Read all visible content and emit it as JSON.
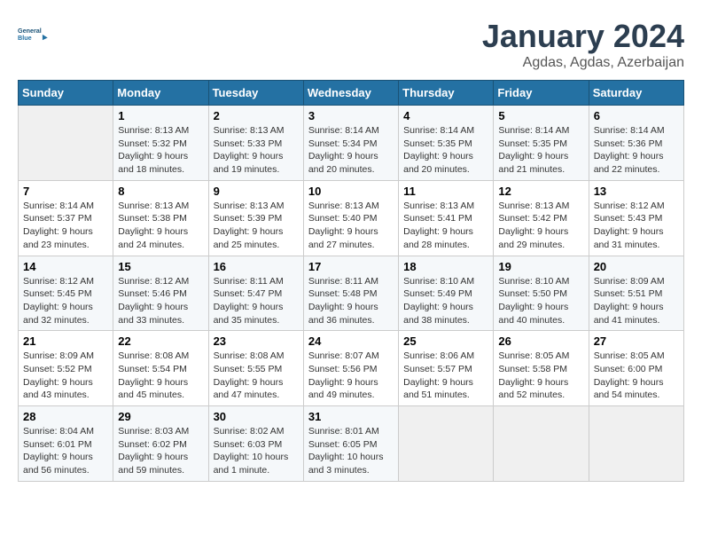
{
  "header": {
    "logo_line1": "General",
    "logo_line2": "Blue",
    "title": "January 2024",
    "subtitle": "Agdas, Agdas, Azerbaijan"
  },
  "days_of_week": [
    "Sunday",
    "Monday",
    "Tuesday",
    "Wednesday",
    "Thursday",
    "Friday",
    "Saturday"
  ],
  "weeks": [
    [
      {
        "day": "",
        "sunrise": "",
        "sunset": "",
        "daylight": "",
        "empty": true
      },
      {
        "day": "1",
        "sunrise": "Sunrise: 8:13 AM",
        "sunset": "Sunset: 5:32 PM",
        "daylight": "Daylight: 9 hours and 18 minutes.",
        "empty": false
      },
      {
        "day": "2",
        "sunrise": "Sunrise: 8:13 AM",
        "sunset": "Sunset: 5:33 PM",
        "daylight": "Daylight: 9 hours and 19 minutes.",
        "empty": false
      },
      {
        "day": "3",
        "sunrise": "Sunrise: 8:14 AM",
        "sunset": "Sunset: 5:34 PM",
        "daylight": "Daylight: 9 hours and 20 minutes.",
        "empty": false
      },
      {
        "day": "4",
        "sunrise": "Sunrise: 8:14 AM",
        "sunset": "Sunset: 5:35 PM",
        "daylight": "Daylight: 9 hours and 20 minutes.",
        "empty": false
      },
      {
        "day": "5",
        "sunrise": "Sunrise: 8:14 AM",
        "sunset": "Sunset: 5:35 PM",
        "daylight": "Daylight: 9 hours and 21 minutes.",
        "empty": false
      },
      {
        "day": "6",
        "sunrise": "Sunrise: 8:14 AM",
        "sunset": "Sunset: 5:36 PM",
        "daylight": "Daylight: 9 hours and 22 minutes.",
        "empty": false
      }
    ],
    [
      {
        "day": "7",
        "sunrise": "Sunrise: 8:14 AM",
        "sunset": "Sunset: 5:37 PM",
        "daylight": "Daylight: 9 hours and 23 minutes.",
        "empty": false
      },
      {
        "day": "8",
        "sunrise": "Sunrise: 8:13 AM",
        "sunset": "Sunset: 5:38 PM",
        "daylight": "Daylight: 9 hours and 24 minutes.",
        "empty": false
      },
      {
        "day": "9",
        "sunrise": "Sunrise: 8:13 AM",
        "sunset": "Sunset: 5:39 PM",
        "daylight": "Daylight: 9 hours and 25 minutes.",
        "empty": false
      },
      {
        "day": "10",
        "sunrise": "Sunrise: 8:13 AM",
        "sunset": "Sunset: 5:40 PM",
        "daylight": "Daylight: 9 hours and 27 minutes.",
        "empty": false
      },
      {
        "day": "11",
        "sunrise": "Sunrise: 8:13 AM",
        "sunset": "Sunset: 5:41 PM",
        "daylight": "Daylight: 9 hours and 28 minutes.",
        "empty": false
      },
      {
        "day": "12",
        "sunrise": "Sunrise: 8:13 AM",
        "sunset": "Sunset: 5:42 PM",
        "daylight": "Daylight: 9 hours and 29 minutes.",
        "empty": false
      },
      {
        "day": "13",
        "sunrise": "Sunrise: 8:12 AM",
        "sunset": "Sunset: 5:43 PM",
        "daylight": "Daylight: 9 hours and 31 minutes.",
        "empty": false
      }
    ],
    [
      {
        "day": "14",
        "sunrise": "Sunrise: 8:12 AM",
        "sunset": "Sunset: 5:45 PM",
        "daylight": "Daylight: 9 hours and 32 minutes.",
        "empty": false
      },
      {
        "day": "15",
        "sunrise": "Sunrise: 8:12 AM",
        "sunset": "Sunset: 5:46 PM",
        "daylight": "Daylight: 9 hours and 33 minutes.",
        "empty": false
      },
      {
        "day": "16",
        "sunrise": "Sunrise: 8:11 AM",
        "sunset": "Sunset: 5:47 PM",
        "daylight": "Daylight: 9 hours and 35 minutes.",
        "empty": false
      },
      {
        "day": "17",
        "sunrise": "Sunrise: 8:11 AM",
        "sunset": "Sunset: 5:48 PM",
        "daylight": "Daylight: 9 hours and 36 minutes.",
        "empty": false
      },
      {
        "day": "18",
        "sunrise": "Sunrise: 8:10 AM",
        "sunset": "Sunset: 5:49 PM",
        "daylight": "Daylight: 9 hours and 38 minutes.",
        "empty": false
      },
      {
        "day": "19",
        "sunrise": "Sunrise: 8:10 AM",
        "sunset": "Sunset: 5:50 PM",
        "daylight": "Daylight: 9 hours and 40 minutes.",
        "empty": false
      },
      {
        "day": "20",
        "sunrise": "Sunrise: 8:09 AM",
        "sunset": "Sunset: 5:51 PM",
        "daylight": "Daylight: 9 hours and 41 minutes.",
        "empty": false
      }
    ],
    [
      {
        "day": "21",
        "sunrise": "Sunrise: 8:09 AM",
        "sunset": "Sunset: 5:52 PM",
        "daylight": "Daylight: 9 hours and 43 minutes.",
        "empty": false
      },
      {
        "day": "22",
        "sunrise": "Sunrise: 8:08 AM",
        "sunset": "Sunset: 5:54 PM",
        "daylight": "Daylight: 9 hours and 45 minutes.",
        "empty": false
      },
      {
        "day": "23",
        "sunrise": "Sunrise: 8:08 AM",
        "sunset": "Sunset: 5:55 PM",
        "daylight": "Daylight: 9 hours and 47 minutes.",
        "empty": false
      },
      {
        "day": "24",
        "sunrise": "Sunrise: 8:07 AM",
        "sunset": "Sunset: 5:56 PM",
        "daylight": "Daylight: 9 hours and 49 minutes.",
        "empty": false
      },
      {
        "day": "25",
        "sunrise": "Sunrise: 8:06 AM",
        "sunset": "Sunset: 5:57 PM",
        "daylight": "Daylight: 9 hours and 51 minutes.",
        "empty": false
      },
      {
        "day": "26",
        "sunrise": "Sunrise: 8:05 AM",
        "sunset": "Sunset: 5:58 PM",
        "daylight": "Daylight: 9 hours and 52 minutes.",
        "empty": false
      },
      {
        "day": "27",
        "sunrise": "Sunrise: 8:05 AM",
        "sunset": "Sunset: 6:00 PM",
        "daylight": "Daylight: 9 hours and 54 minutes.",
        "empty": false
      }
    ],
    [
      {
        "day": "28",
        "sunrise": "Sunrise: 8:04 AM",
        "sunset": "Sunset: 6:01 PM",
        "daylight": "Daylight: 9 hours and 56 minutes.",
        "empty": false
      },
      {
        "day": "29",
        "sunrise": "Sunrise: 8:03 AM",
        "sunset": "Sunset: 6:02 PM",
        "daylight": "Daylight: 9 hours and 59 minutes.",
        "empty": false
      },
      {
        "day": "30",
        "sunrise": "Sunrise: 8:02 AM",
        "sunset": "Sunset: 6:03 PM",
        "daylight": "Daylight: 10 hours and 1 minute.",
        "empty": false
      },
      {
        "day": "31",
        "sunrise": "Sunrise: 8:01 AM",
        "sunset": "Sunset: 6:05 PM",
        "daylight": "Daylight: 10 hours and 3 minutes.",
        "empty": false
      },
      {
        "day": "",
        "sunrise": "",
        "sunset": "",
        "daylight": "",
        "empty": true
      },
      {
        "day": "",
        "sunrise": "",
        "sunset": "",
        "daylight": "",
        "empty": true
      },
      {
        "day": "",
        "sunrise": "",
        "sunset": "",
        "daylight": "",
        "empty": true
      }
    ]
  ]
}
